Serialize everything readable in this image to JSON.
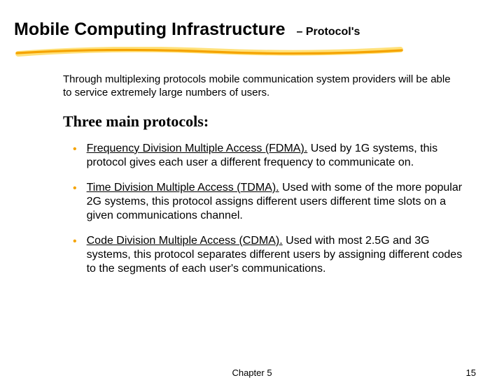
{
  "title": {
    "main": "Mobile Computing Infrastructure",
    "sub": "– Protocol's"
  },
  "intro": "Through multiplexing protocols mobile communication system providers will be able to service extremely large numbers of users.",
  "subheading": "Three main protocols:",
  "bullets": [
    {
      "lead": "Frequency Division Multiple Access (FDMA).",
      "rest": " Used by 1G systems, this protocol gives each user a different frequency to communicate on."
    },
    {
      "lead": "Time Division Multiple Access (TDMA).",
      "rest": " Used with some of the more popular 2G systems, this protocol assigns different users different time slots on a given communications channel."
    },
    {
      "lead": "Code Division Multiple Access (CDMA).",
      "rest": " Used with most 2.5G and 3G systems, this protocol separates different users by assigning different codes to the segments of each user's communications."
    }
  ],
  "footer": {
    "center": "Chapter 5",
    "pageNumber": "15"
  },
  "colors": {
    "accent": "#f5a300",
    "underlineLight": "#ffe17a"
  }
}
